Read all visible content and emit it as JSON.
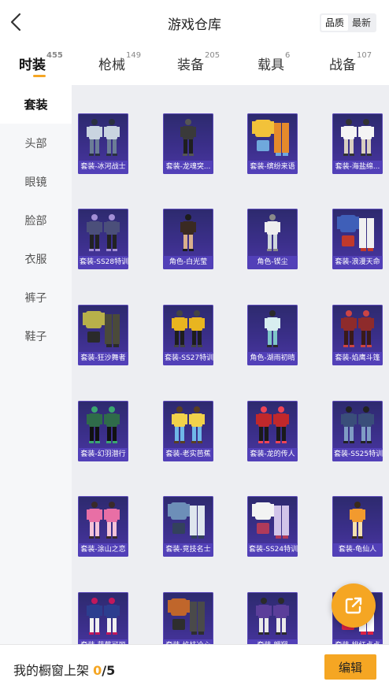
{
  "header": {
    "title": "游戏仓库",
    "sort_options": [
      "品质",
      "最新"
    ],
    "active_sort": "品质"
  },
  "tabs": [
    {
      "label": "时装",
      "count": "455",
      "active": true
    },
    {
      "label": "枪械",
      "count": "149",
      "active": false
    },
    {
      "label": "装备",
      "count": "205",
      "active": false
    },
    {
      "label": "载具",
      "count": "6",
      "active": false
    },
    {
      "label": "战备",
      "count": "107",
      "active": false
    }
  ],
  "sidebar": {
    "items": [
      {
        "label": "套装",
        "active": true
      },
      {
        "label": "头部",
        "active": false
      },
      {
        "label": "眼镜",
        "active": false
      },
      {
        "label": "脸部",
        "active": false
      },
      {
        "label": "衣服",
        "active": false
      },
      {
        "label": "裤子",
        "active": false
      },
      {
        "label": "鞋子",
        "active": false
      }
    ]
  },
  "items": [
    {
      "label": "套装-冰河战士",
      "art": "pair-armor"
    },
    {
      "label": "套装-龙魂突...",
      "art": "single-dark"
    },
    {
      "label": "套装-缤纷来语",
      "art": "outfit-yellow"
    },
    {
      "label": "套装-海盐绵...",
      "art": "pair-light"
    },
    {
      "label": "套装-SS28特训",
      "art": "pair-dark"
    },
    {
      "label": "角色-白光莹",
      "art": "single-female"
    },
    {
      "label": "角色-锲尘",
      "art": "single-white"
    },
    {
      "label": "套装-浪漫天命",
      "art": "outfit-blue"
    },
    {
      "label": "套装-狂沙舞者",
      "art": "outfit-green"
    },
    {
      "label": "套装-SS27特训",
      "art": "pair-yellow"
    },
    {
      "label": "角色-湖雨初晴",
      "art": "single-cyan"
    },
    {
      "label": "套装-焰鹰斗篷",
      "art": "pair-red"
    },
    {
      "label": "套装-幻羽潜行",
      "art": "pair-green"
    },
    {
      "label": "套装-老实芭蕉",
      "art": "pair-banana"
    },
    {
      "label": "套装-龙的传人",
      "art": "pair-crimson"
    },
    {
      "label": "套装-SS25特训",
      "art": "pair-navy"
    },
    {
      "label": "套装-涂山之恋",
      "art": "pair-pink"
    },
    {
      "label": "套装-竞技名士",
      "art": "outfit-denim"
    },
    {
      "label": "套装-SS24特训",
      "art": "outfit-white"
    },
    {
      "label": "套装-龟仙人",
      "art": "single-orange"
    },
    {
      "label": "套装-蓝莓可丽",
      "art": "pair-blueberry"
    },
    {
      "label": "套装-焰枝冷心",
      "art": "outfit-rust"
    },
    {
      "label": "套装-翱翔",
      "art": "pair-purple"
    },
    {
      "label": "套装-桃红点点",
      "art": "outfit-peach"
    }
  ],
  "colors": {
    "accent": "#f5a623",
    "card_bg": "#3b2f8a",
    "card_label_bg": "#5240b8",
    "grid_bg": "#edeef2"
  },
  "footer": {
    "window_label": "我的橱窗上架 ",
    "shelved_count": "0",
    "separator_total": "/5",
    "edit_label": "编辑"
  },
  "icons": {
    "back": "chevron-left-icon",
    "share": "external-link-icon"
  }
}
